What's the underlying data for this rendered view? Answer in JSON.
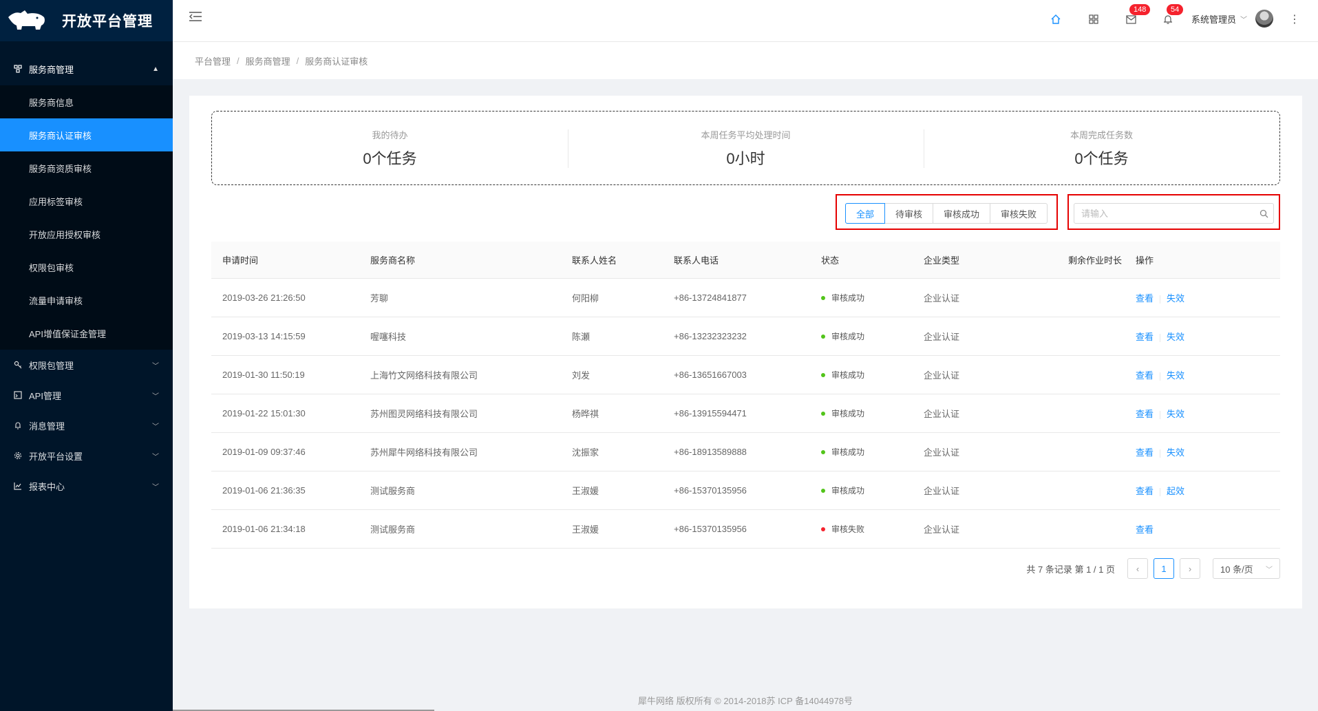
{
  "app": {
    "title": "开放平台管理"
  },
  "sidebar": {
    "group": {
      "label": "服务商管理",
      "icon": "cluster-icon",
      "expanded": true
    },
    "subitems": [
      {
        "label": "服务商信息",
        "active": false
      },
      {
        "label": "服务商认证审核",
        "active": true
      },
      {
        "label": "服务商资质审核",
        "active": false
      },
      {
        "label": "应用标签审核",
        "active": false
      },
      {
        "label": "开放应用授权审核",
        "active": false
      },
      {
        "label": "权限包审核",
        "active": false
      },
      {
        "label": "流量申请审核",
        "active": false
      },
      {
        "label": "API增值保证金管理",
        "active": false
      }
    ],
    "items": [
      {
        "label": "权限包管理",
        "icon": "key-icon"
      },
      {
        "label": "API管理",
        "icon": "api-icon"
      },
      {
        "label": "消息管理",
        "icon": "bell-icon"
      },
      {
        "label": "开放平台设置",
        "icon": "gear-icon"
      },
      {
        "label": "报表中心",
        "icon": "chart-icon"
      }
    ]
  },
  "header": {
    "mail_badge": "148",
    "bell_badge": "54",
    "user_name": "系统管理员"
  },
  "breadcrumb": [
    "平台管理",
    "服务商管理",
    "服务商认证审核"
  ],
  "stats": [
    {
      "label": "我的待办",
      "value": "0个任务"
    },
    {
      "label": "本周任务平均处理时间",
      "value": "0小时"
    },
    {
      "label": "本周完成任务数",
      "value": "0个任务"
    }
  ],
  "filters": {
    "tabs": [
      "全部",
      "待审核",
      "审核成功",
      "审核失败"
    ],
    "selected": "全部"
  },
  "search": {
    "placeholder": "请输入",
    "value": ""
  },
  "table": {
    "columns": [
      "申请时间",
      "服务商名称",
      "联系人姓名",
      "联系人电话",
      "状态",
      "企业类型",
      "剩余作业时长",
      "操作"
    ],
    "rows": [
      {
        "time": "2019-03-26 21:26:50",
        "name": "芳聊",
        "contact": "何阳柳",
        "phone": "+86-13724841877",
        "status": "审核成功",
        "status_color": "#52c41a",
        "type": "企业认证",
        "remaining": "",
        "action1": "查看",
        "action2": "失效"
      },
      {
        "time": "2019-03-13 14:15:59",
        "name": "喔噻科技",
        "contact": "陈瀬",
        "phone": "+86-13232323232",
        "status": "审核成功",
        "status_color": "#52c41a",
        "type": "企业认证",
        "remaining": "",
        "action1": "查看",
        "action2": "失效"
      },
      {
        "time": "2019-01-30 11:50:19",
        "name": "上海竹文网络科技有限公司",
        "contact": "刘发",
        "phone": "+86-13651667003",
        "status": "审核成功",
        "status_color": "#52c41a",
        "type": "企业认证",
        "remaining": "",
        "action1": "查看",
        "action2": "失效"
      },
      {
        "time": "2019-01-22 15:01:30",
        "name": "苏州图灵网络科技有限公司",
        "contact": "杨晔祺",
        "phone": "+86-13915594471",
        "status": "审核成功",
        "status_color": "#52c41a",
        "type": "企业认证",
        "remaining": "",
        "action1": "查看",
        "action2": "失效"
      },
      {
        "time": "2019-01-09 09:37:46",
        "name": "苏州犀牛网络科技有限公司",
        "contact": "沈振家",
        "phone": "+86-18913589888",
        "status": "审核成功",
        "status_color": "#52c41a",
        "type": "企业认证",
        "remaining": "",
        "action1": "查看",
        "action2": "失效"
      },
      {
        "time": "2019-01-06 21:36:35",
        "name": "测试服务商",
        "contact": "王淑媛",
        "phone": "+86-15370135956",
        "status": "审核成功",
        "status_color": "#52c41a",
        "type": "企业认证",
        "remaining": "",
        "action1": "查看",
        "action2": "起效"
      },
      {
        "time": "2019-01-06 21:34:18",
        "name": "测试服务商",
        "contact": "王淑媛",
        "phone": "+86-15370135956",
        "status": "审核失败",
        "status_color": "#f5222d",
        "type": "企业认证",
        "remaining": "",
        "action1": "查看",
        "action2": ""
      }
    ]
  },
  "pagination": {
    "total_text": "共 7 条记录 第 1 / 1 页",
    "current": "1",
    "page_size": "10 条/页"
  },
  "footer": {
    "text": "犀牛网络 版权所有 © 2014-2018苏 ICP 备14044978号"
  },
  "colors": {
    "primary": "#1890ff",
    "sidebar_bg": "#001529",
    "highlight_border": "#e50000"
  }
}
